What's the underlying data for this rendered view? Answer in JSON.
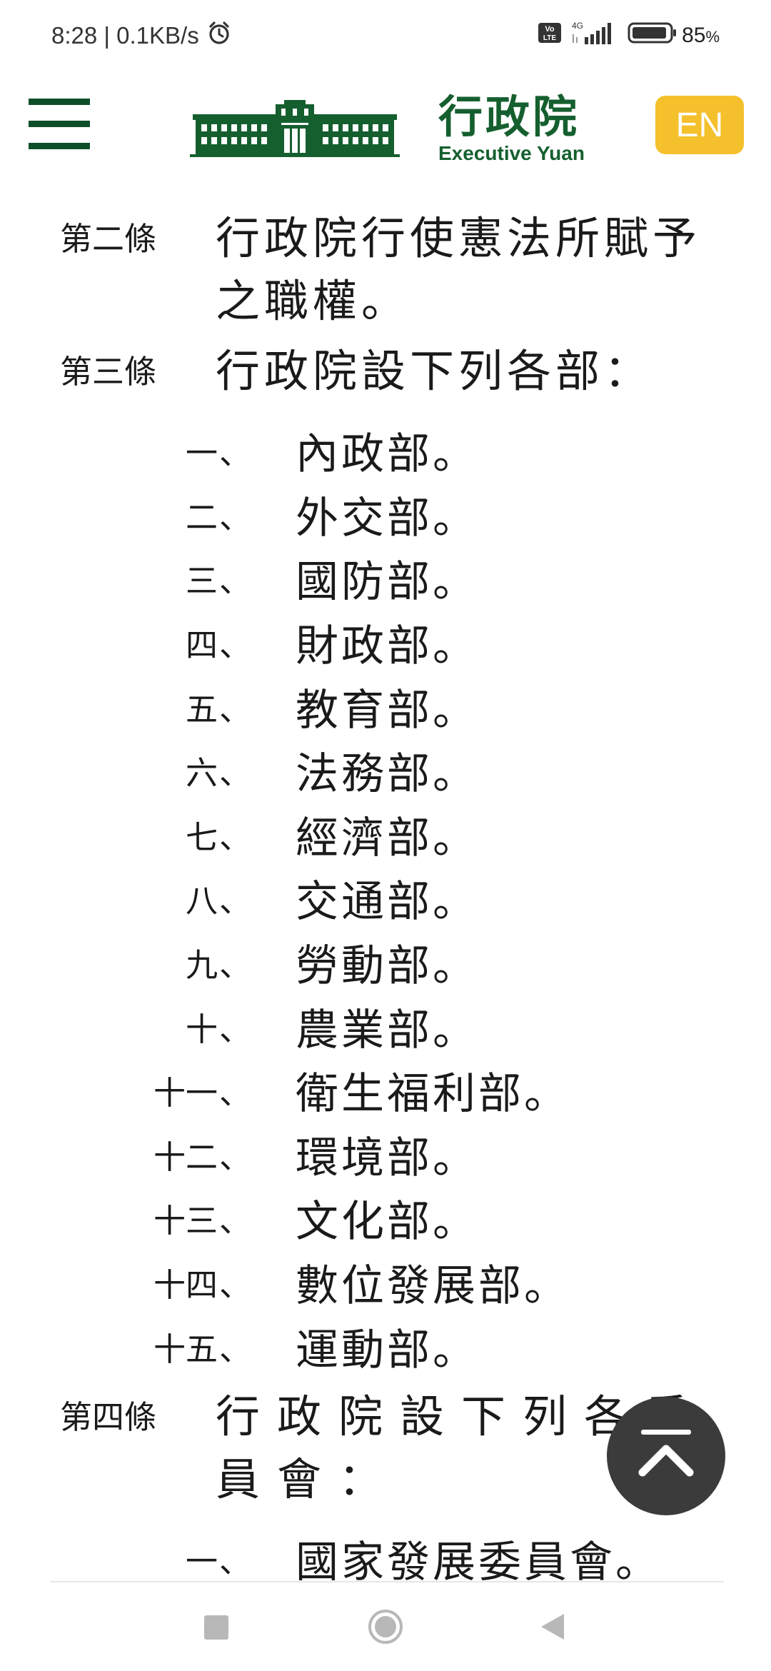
{
  "status_bar": {
    "time": "8:28",
    "network_speed": "0.1KB/s",
    "alarm_icon": "alarm-clock-icon",
    "volte_label": "Vo LTE",
    "network_type": "4G",
    "battery_percent": "85",
    "battery_unit": "%"
  },
  "header": {
    "menu_icon": "hamburger-menu-icon",
    "logo_zh": "行政院",
    "logo_en": "Executive Yuan",
    "lang_button": "EN",
    "brand_color": "#155f2f",
    "lang_color": "#f4c02b"
  },
  "articles": [
    {
      "number": "第二條",
      "text": "行政院行使憲法所賦予之職權。",
      "items": []
    },
    {
      "number": "第三條",
      "text": "行政院設下列各部：",
      "items": [
        {
          "num": "一",
          "name": "內政部"
        },
        {
          "num": "二",
          "name": "外交部"
        },
        {
          "num": "三",
          "name": "國防部"
        },
        {
          "num": "四",
          "name": "財政部"
        },
        {
          "num": "五",
          "name": "教育部"
        },
        {
          "num": "六",
          "name": "法務部"
        },
        {
          "num": "七",
          "name": "經濟部"
        },
        {
          "num": "八",
          "name": "交通部"
        },
        {
          "num": "九",
          "name": "勞動部"
        },
        {
          "num": "十",
          "name": "農業部"
        },
        {
          "num": "十一",
          "name": "衛生福利部"
        },
        {
          "num": "十二",
          "name": "環境部"
        },
        {
          "num": "十三",
          "name": "文化部"
        },
        {
          "num": "十四",
          "name": "數位發展部"
        },
        {
          "num": "十五",
          "name": "運動部"
        }
      ]
    },
    {
      "number": "第四條",
      "text": "行政院設下列各委員會：",
      "items": [
        {
          "num": "一",
          "name": "國家發展委員會"
        }
      ]
    }
  ],
  "punctuation": {
    "enum_sep": "、",
    "item_end": "。"
  },
  "back_to_top_icon": "chevron-up-icon",
  "nav_bar": {
    "recent_icon": "square-recent-apps-icon",
    "home_icon": "circle-home-icon",
    "back_icon": "triangle-back-icon"
  }
}
